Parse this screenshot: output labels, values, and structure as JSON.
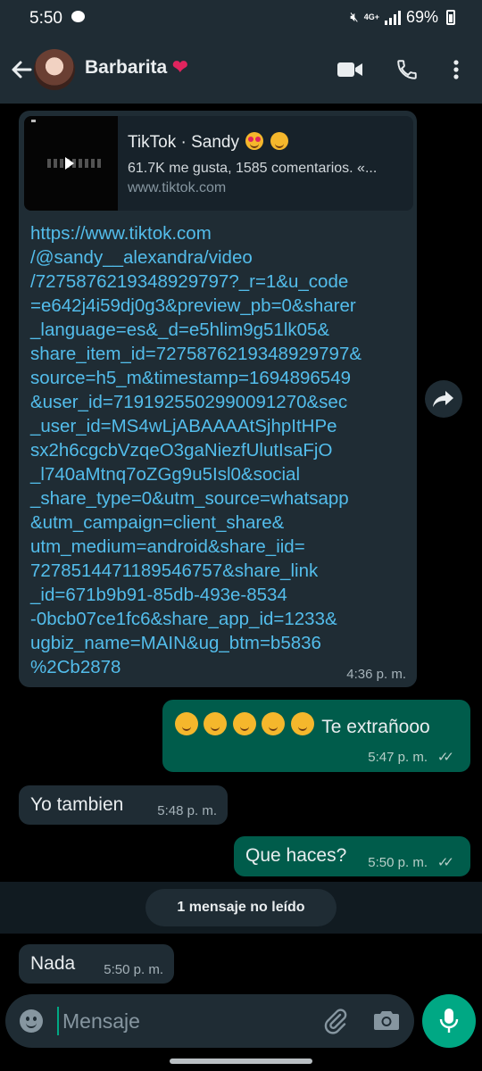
{
  "status_bar": {
    "time": "5:50",
    "network": "4G+",
    "battery": "69%"
  },
  "header": {
    "contact_name": "Barbarita"
  },
  "messages": [
    {
      "direction": "incoming",
      "preview": {
        "title": "TikTok · Sandy",
        "description": "61.7K me gusta, 1585 comentarios. «...",
        "domain": "www.tiktok.com"
      },
      "link_lines": [
        "https://www.tiktok.com",
        "/@sandy__alexandra/video",
        "/7275876219348929797?_r=1&u_code",
        "=e642j4i59dj0g3&preview_pb=0&sharer",
        "_language=es&_d=e5hlim9g51lk05&",
        "share_item_id=7275876219348929797&",
        "source=h5_m&timestamp=1694896549",
        "&user_id=7191925502990091270&sec",
        "_user_id=MS4wLjABAAAAtSjhpItHPe",
        "sx2h6cgcbVzqeO3gaNiezfUlutIsaFjO",
        "_l740aMtnq7oZGg9u5Isl0&social",
        "_share_type=0&utm_source=whatsapp",
        "&utm_campaign=client_share&",
        "utm_medium=android&share_iid=",
        "7278514471189546757&share_link",
        "_id=671b9b91-85db-493e-8534",
        "-0bcb07ce1fc6&share_app_id=1233&",
        "ugbiz_name=MAIN&ug_btm=b5836",
        "%2Cb2878"
      ],
      "time": "4:36 p. m."
    },
    {
      "direction": "outgoing",
      "text": "Te extrañooo",
      "time": "5:47 p. m."
    },
    {
      "direction": "incoming",
      "text": "Yo tambien",
      "time": "5:48 p. m."
    },
    {
      "direction": "outgoing",
      "text": "Que haces?",
      "time": "5:50 p. m."
    },
    {
      "direction": "incoming",
      "text": "Nada",
      "time": "5:50 p. m."
    }
  ],
  "unread_label": "1 mensaje no leído",
  "input": {
    "placeholder": "Mensaje",
    "value": ""
  },
  "colors": {
    "header_bg": "#1f2c34",
    "incoming_bubble": "#1f2c34",
    "outgoing_bubble": "#005c4b",
    "link": "#53bdeb",
    "accent": "#00a884"
  },
  "icons": {
    "back": "arrow-left-icon",
    "video_call": "video-camera-icon",
    "voice_call": "phone-icon",
    "menu": "more-vert-icon",
    "forward": "forward-arrow-icon",
    "emoji": "emoji-icon",
    "attach": "paperclip-icon",
    "camera": "camera-icon",
    "mic": "microphone-icon"
  }
}
